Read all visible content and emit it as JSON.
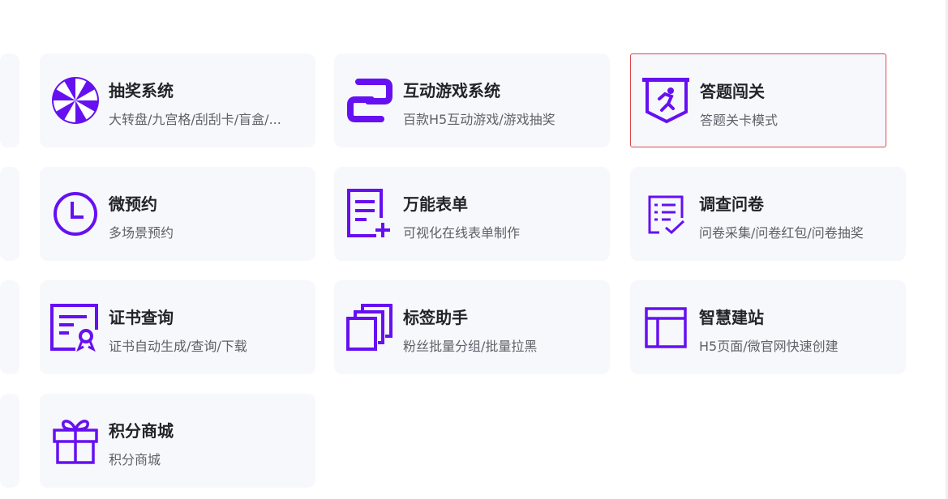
{
  "colors": {
    "accent": "#6610f2",
    "card_bg": "#f7f8fc",
    "selected_border": "#e0474c"
  },
  "cards": [
    {
      "title": "抽奖系统",
      "desc": "大转盘/九宫格/刮刮卡/盲盒/...",
      "icon": "lottery-wheel-icon"
    },
    {
      "title": "互动游戏系统",
      "desc": "百款H5互动游戏/游戏抽奖",
      "icon": "interactive-game-icon"
    },
    {
      "title": "答题闯关",
      "desc": "答题关卡模式",
      "icon": "quiz-runner-badge-icon"
    },
    {
      "title": "微预约",
      "desc": "多场景预约",
      "icon": "clock-icon"
    },
    {
      "title": "万能表单",
      "desc": "可视化在线表单制作",
      "icon": "form-add-icon"
    },
    {
      "title": "调查问卷",
      "desc": "问卷采集/问卷红包/问卷抽奖",
      "icon": "survey-checklist-icon"
    },
    {
      "title": "证书查询",
      "desc": "证书自动生成/查询/下载",
      "icon": "certificate-icon"
    },
    {
      "title": "标签助手",
      "desc": "粉丝批量分组/批量拉黑",
      "icon": "stacked-tags-icon"
    },
    {
      "title": "智慧建站",
      "desc": "H5页面/微官网快速创建",
      "icon": "website-layout-icon"
    },
    {
      "title": "积分商城",
      "desc": "积分商城",
      "icon": "gift-icon"
    }
  ]
}
